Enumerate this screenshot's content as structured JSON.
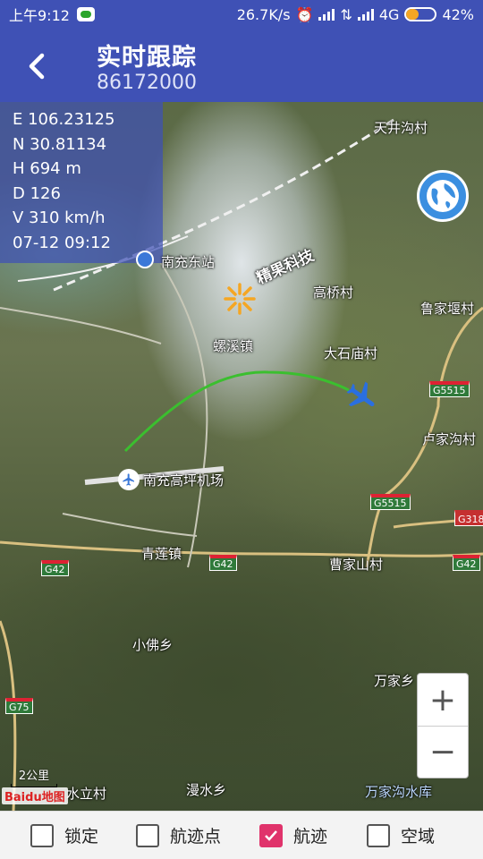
{
  "status_bar": {
    "time": "上午9:12",
    "speed": "26.7K/s",
    "network": "4G",
    "battery": "42%",
    "battery_level": 0.42
  },
  "header": {
    "title": "实时跟踪",
    "subtitle": "86172000"
  },
  "info": {
    "lon": "E 106.23125",
    "lat": "N 30.81134",
    "height": "H 694 m",
    "direction": "D 126",
    "velocity": "V 310 km/h",
    "time": "07-12 09:12"
  },
  "map": {
    "places": {
      "tianjinggou": "天井沟村",
      "nanchong_station": "南充东站",
      "brand": "精果科技",
      "gaoqiao": "高桥村",
      "lujiayan": "鲁家堰村",
      "luoxi": "螺溪镇",
      "dashimiao": "大石庙村",
      "lujiagou": "卢家沟村",
      "airport": "南充高坪机场",
      "qinglian": "青莲镇",
      "caojiashan": "曹家山村",
      "xiaofo": "小佛乡",
      "wanjia": "万家乡",
      "manshui": "漫水乡",
      "shuili": "水立村",
      "wanjia_reservoir": "万家沟水库"
    },
    "shields": {
      "g5515_a": "G5515",
      "g5515_b": "G5515",
      "g318": "G318",
      "g42_a": "G42",
      "g42_b": "G42",
      "g42_c": "G42",
      "g75": "G75"
    },
    "scale_label": "2公里",
    "baidu_logo": "Baidu地图",
    "zoom_in": "+",
    "zoom_out": "−"
  },
  "options": [
    {
      "label": "锁定",
      "checked": false
    },
    {
      "label": "航迹点",
      "checked": false
    },
    {
      "label": "航迹",
      "checked": true
    },
    {
      "label": "空域",
      "checked": false
    }
  ],
  "colors": {
    "primary": "#3f51b5",
    "checkbox_on": "#e0336b",
    "track": "#3bbf2f"
  }
}
